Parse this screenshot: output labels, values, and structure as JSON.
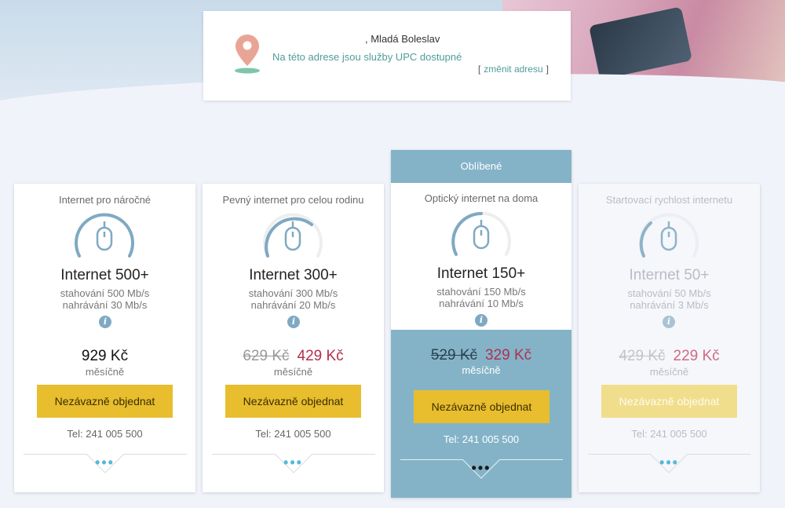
{
  "address": {
    "city_suffix": ", Mladá Boleslav",
    "status": "Na této adrese jsou služby UPC dostupné",
    "change_open": "[",
    "change_link": "změnit adresu",
    "change_close": "]"
  },
  "featured_label": "Oblíbené",
  "plans": [
    {
      "heading": "Internet pro náročné",
      "name": "Internet 500+",
      "download": "stahování 500 Mb/s",
      "upload": "nahrávání 30 Mb/s",
      "price_old": "",
      "price_new": "929 Kč",
      "per_month": "měsíčně",
      "order_label": "Nezávazně objednat",
      "tel": "Tel: 241 005 500",
      "more": "•••",
      "gauge_level": 1.0
    },
    {
      "heading": "Pevný internet pro celou rodinu",
      "name": "Internet 300+",
      "download": "stahování 300 Mb/s",
      "upload": "nahrávání 20 Mb/s",
      "price_old": "629 Kč",
      "price_new": "429 Kč",
      "per_month": "měsíčně",
      "order_label": "Nezávazně objednat",
      "tel": "Tel: 241 005 500",
      "more": "•••",
      "gauge_level": 0.7
    },
    {
      "heading": "Optický internet na doma",
      "name": "Internet 150+",
      "download": "stahování 150 Mb/s",
      "upload": "nahrávání 10 Mb/s",
      "price_old": "529 Kč",
      "price_new": "329 Kč",
      "per_month": "měsíčně",
      "order_label": "Nezávazně objednat",
      "tel": "Tel: 241 005 500",
      "more": "•••",
      "gauge_level": 0.45
    },
    {
      "heading": "Startovací rychlost internetu",
      "name": "Internet 50+",
      "download": "stahování 50 Mb/s",
      "upload": "nahrávání 3 Mb/s",
      "price_old": "429 Kč",
      "price_new": "229 Kč",
      "per_month": "měsíčně",
      "order_label": "Nezávazně objednat",
      "tel": "Tel: 241 005 500",
      "more": "•••",
      "gauge_level": 0.25
    }
  ],
  "colors": {
    "accent_teal": "#4f9d9a",
    "gauge_blue": "#7fa9c3",
    "button_yellow": "#e8bd2e",
    "price_red": "#b0304f",
    "featured_blue": "#84b3c8"
  },
  "icons": {
    "location": "location-pin-icon",
    "info": "info-icon",
    "mouse": "mouse-icon"
  }
}
